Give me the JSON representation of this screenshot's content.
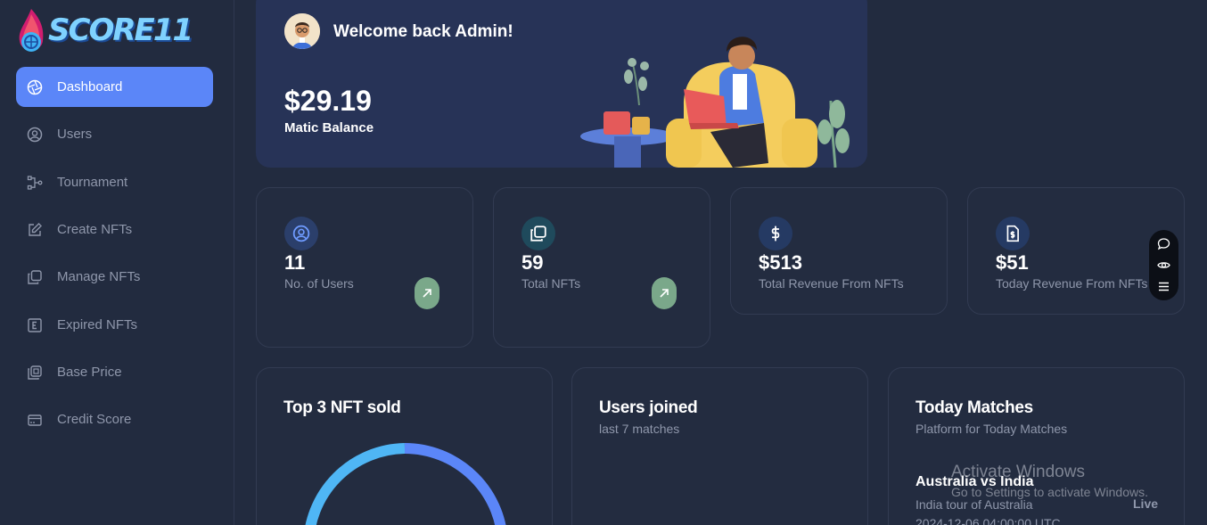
{
  "brand": {
    "name": "SCORE11"
  },
  "sidebar": {
    "items": [
      {
        "label": "Dashboard",
        "icon": "aperture-icon",
        "active": true
      },
      {
        "label": "Users",
        "icon": "user-circle-icon"
      },
      {
        "label": "Tournament",
        "icon": "tournament-tree-icon"
      },
      {
        "label": "Create NFTs",
        "icon": "edit-icon"
      },
      {
        "label": "Manage NFTs",
        "icon": "copy-icon"
      },
      {
        "label": "Expired NFTs",
        "icon": "e-square-icon"
      },
      {
        "label": "Base Price",
        "icon": "price-tag-icon"
      },
      {
        "label": "Credit Score",
        "icon": "credit-card-icon"
      }
    ]
  },
  "hero": {
    "welcome": "Welcome back Admin!",
    "balance": "$29.19",
    "balance_label": "Matic Balance"
  },
  "stats": [
    {
      "value": "11",
      "label": "No. of Users",
      "icon": "user-circle-icon",
      "trend_icon": "arrow-up-right-icon"
    },
    {
      "value": "59",
      "label": "Total NFTs",
      "icon": "copy-icon",
      "trend_icon": "arrow-up-right-icon"
    },
    {
      "value": "$513",
      "label": "Total Revenue From NFTs",
      "icon": "dollar-icon"
    },
    {
      "value": "$51",
      "label": "Today Revenue From NFTs",
      "icon": "file-dollar-icon"
    }
  ],
  "floating_toolbar": {
    "icons": [
      "chat-icon",
      "eye-icon",
      "menu-icon"
    ]
  },
  "panels": {
    "top_nft": {
      "title": "Top 3 NFT sold"
    },
    "users_joined": {
      "title": "Users joined",
      "subtitle": "last 7 matches"
    },
    "today_matches": {
      "title": "Today Matches",
      "subtitle": "Platform for Today Matches",
      "match": {
        "title": "Australia vs India",
        "series": "India tour of Australia",
        "time": "2024-12-06 04:00:00 UTC",
        "status": "Live"
      }
    }
  },
  "watermark": {
    "title": "Activate Windows",
    "subtitle": "Go to Settings to activate Windows."
  },
  "colors": {
    "background": "#222b3f",
    "accent": "#5b86f8",
    "hero": "#273357",
    "trend_badge": "#7aa88a",
    "donut_primary": "#5b86f8",
    "donut_secondary": "#4fb6f5"
  }
}
